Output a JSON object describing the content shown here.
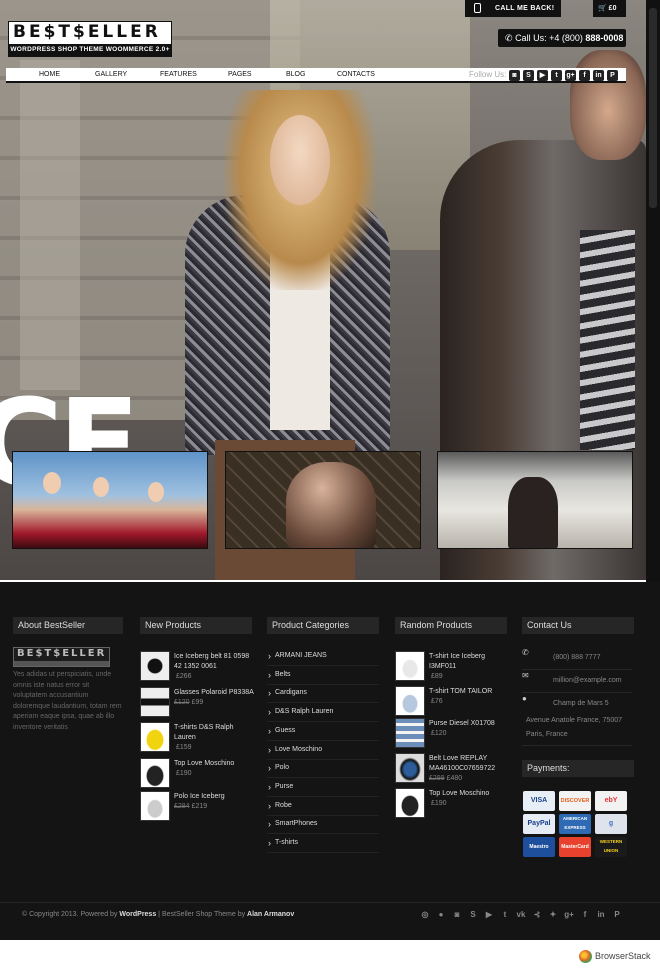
{
  "header": {
    "logo_brand": "BE$T$ELLER",
    "logo_tagline": "WORDPRESS SHOP THEME WOOMMERCE 2.0+",
    "callback_label": "CALL ME BACK!",
    "cart_label": "£0",
    "phone_prefix": "Call Us: +4 (800) ",
    "phone_number": "888-0008"
  },
  "nav": {
    "items": [
      "HOME",
      "GALLERY",
      "FEATURES",
      "PAGES",
      "BLOG",
      "CONTACTS"
    ],
    "follow_label": "Follow Us:",
    "social_icons": [
      "instagram-icon",
      "skype-icon",
      "youtube-icon",
      "twitter-icon",
      "googleplus-icon",
      "facebook-icon",
      "linkedin-icon",
      "pinterest-icon"
    ]
  },
  "hero": {
    "big_letters": "CE"
  },
  "about": {
    "heading": "About BestSeller",
    "text": "Yes adidas ut perspiciatis, unde omnis iste natus error sit voluptatem accusantium doloremque laudantium, totam rem aperiam eaque ipsa, quae ab illo inventore veritatis"
  },
  "new_products": {
    "heading": "New Products",
    "items": [
      {
        "name": "Ice Iceberg belt 81 0598 42 1352 0061",
        "old_price": "",
        "price": "£266"
      },
      {
        "name": "Glasses Polaroid P8338A",
        "old_price": "£120",
        "price": "£99"
      },
      {
        "name": "T-shirts D&S Ralph Lauren",
        "old_price": "",
        "price": "£159"
      },
      {
        "name": "Top Love Moschino",
        "old_price": "",
        "price": "£190"
      },
      {
        "name": "Polo Ice Iceberg",
        "old_price": "£284",
        "price": "£219"
      }
    ]
  },
  "categories": {
    "heading": "Product Categories",
    "items": [
      "ARMANI JEANS",
      "Belts",
      "Cardigans",
      "D&S Ralph Lauren",
      "Guess",
      "Love Moschino",
      "Polo",
      "Purse",
      "Robe",
      "SmartPhones",
      "T-shirts"
    ]
  },
  "random_products": {
    "heading": "Random Products",
    "items": [
      {
        "name": "T-shirt Ice Iceberg I3MF011",
        "old_price": "",
        "price": "£89"
      },
      {
        "name": "T-shirt TOM TAILOR",
        "old_price": "",
        "price": "£76"
      },
      {
        "name": "Purse Diesel X01708",
        "old_price": "",
        "price": "£120"
      },
      {
        "name": "Belt Love REPLAY MA46100C07659722",
        "old_price": "£299",
        "price": "£480"
      },
      {
        "name": "Top Love Moschino",
        "old_price": "",
        "price": "£190"
      }
    ]
  },
  "contact": {
    "heading": "Contact Us",
    "phone": "(800) 888 7777",
    "email": "million@example.com",
    "address_line1": "Champ de Mars 5",
    "address_line2": "Avenue Anatole France, 75007",
    "address_line3": "Paris, France",
    "payments_heading": "Payments:",
    "payments": [
      "VISA",
      "DISCOVER",
      "ebY",
      "PayPal",
      "AMERICAN EXPRESS",
      "g",
      "Maestro",
      "MasterCard",
      "WESTERN UNION"
    ]
  },
  "footer": {
    "copyright_prefix": "© Copyright 2013. Powered by ",
    "wordpress": "WordPress",
    "copyright_mid": " | BestSeller Shop Theme by ",
    "author": "Alan Armanov",
    "icons": [
      "dribbble-icon",
      "flickr-icon",
      "instagram-icon",
      "skype-icon",
      "youtube-icon",
      "tumblr-icon",
      "vk-icon",
      "rss-icon",
      "twitter-icon",
      "googleplus-icon",
      "facebook-icon",
      "linkedin-icon",
      "pinterest-icon"
    ]
  },
  "browserstack": {
    "label": "BrowserStack"
  },
  "colors": {
    "footer_bg": "#141414",
    "heading_bg": "#262626",
    "accent": "#111111"
  }
}
